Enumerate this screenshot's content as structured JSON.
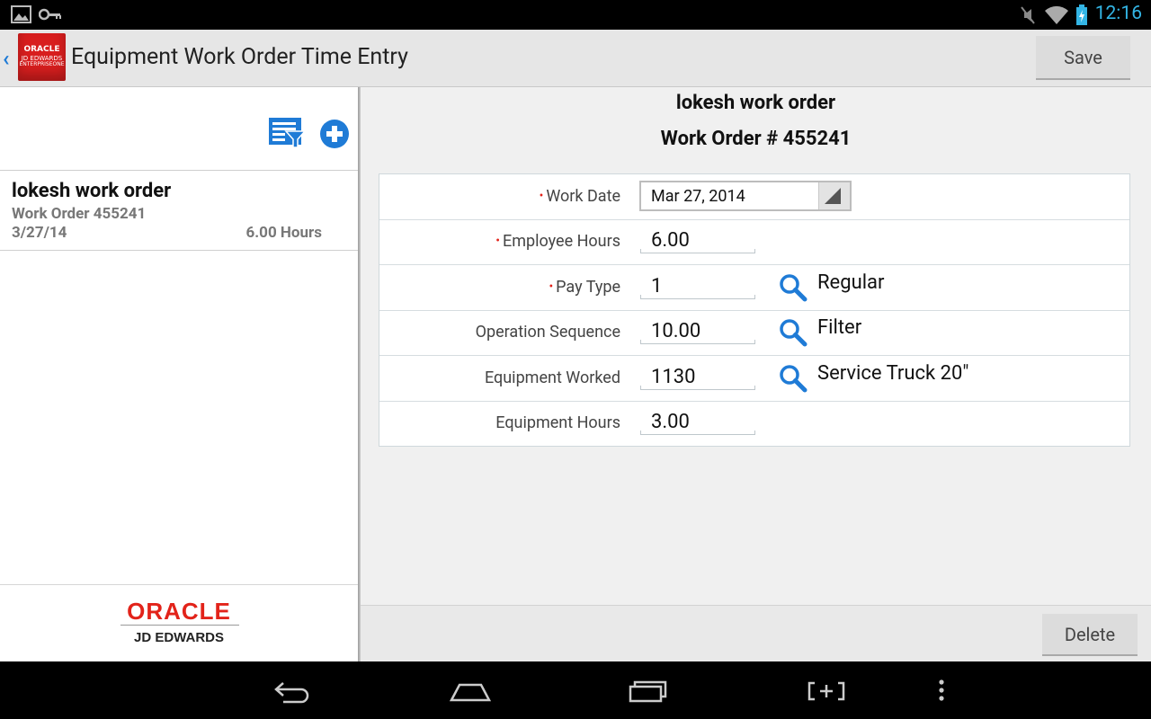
{
  "status_bar": {
    "time": "12:16"
  },
  "action_bar": {
    "title": "Equipment Work Order Time Entry",
    "logo_lines": [
      "ORACLE",
      "JD EDWARDS",
      "ENTERPRISEONE"
    ],
    "save_label": "Save"
  },
  "list": {
    "items": [
      {
        "title": "lokesh work order",
        "subtitle": "Work Order 455241",
        "date": "3/27/14",
        "hours": "6.00 Hours"
      }
    ]
  },
  "footer": {
    "brand": "ORACLE",
    "brand_sub": "JD EDWARDS"
  },
  "detail": {
    "title": "lokesh work order",
    "subtitle": "Work Order # 455241",
    "fields": {
      "work_date": {
        "label": "Work Date",
        "required": true,
        "value": "Mar 27, 2014"
      },
      "employee_hours": {
        "label": "Employee Hours",
        "required": true,
        "value": "6.00"
      },
      "pay_type": {
        "label": "Pay Type",
        "required": true,
        "value": "1",
        "description": "Regular"
      },
      "operation_sequence": {
        "label": "Operation Sequence",
        "required": false,
        "value": "10.00",
        "description": "Filter"
      },
      "equipment_worked": {
        "label": "Equipment Worked",
        "required": false,
        "value": "1130",
        "description": "Service Truck 20\""
      },
      "equipment_hours": {
        "label": "Equipment Hours",
        "required": false,
        "value": "3.00"
      }
    },
    "required_marker": "•",
    "delete_label": "Delete"
  },
  "colors": {
    "accent": "#1f7bd6",
    "required": "#e2231a",
    "brand_red": "#d81e1e",
    "clock": "#33b5e5"
  }
}
